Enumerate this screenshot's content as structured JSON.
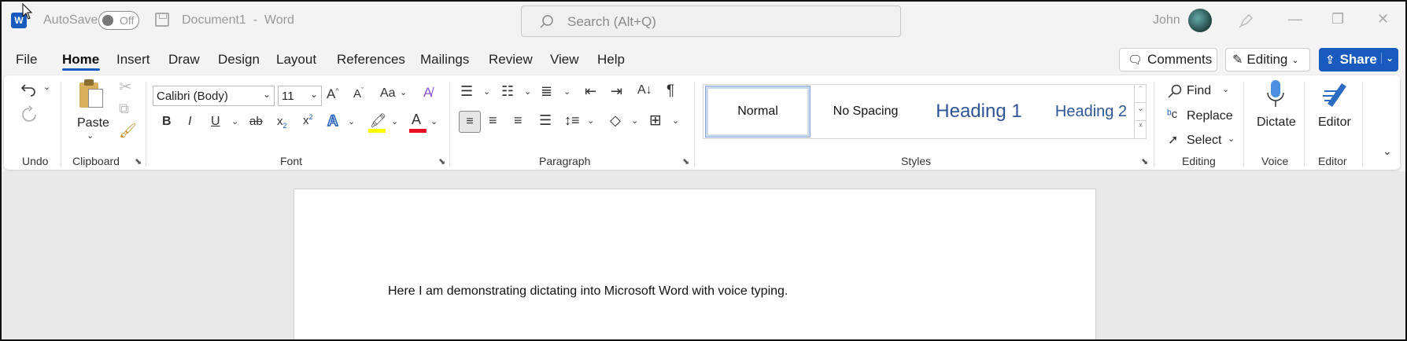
{
  "titlebar": {
    "app_icon": "word-icon",
    "autosave_label": "AutoSave",
    "autosave_state": "Off",
    "save_icon": "save-icon",
    "document_title": "Document1  -  Word",
    "search_placeholder": "Search (Alt+Q)",
    "user_name": "John"
  },
  "tabs": [
    "File",
    "Home",
    "Insert",
    "Draw",
    "Design",
    "Layout",
    "References",
    "Mailings",
    "Review",
    "View",
    "Help"
  ],
  "active_tab": "Home",
  "actions": {
    "comments_label": "Comments",
    "editing_label": "Editing",
    "share_label": "Share"
  },
  "ribbon": {
    "undo": {
      "label": "Undo"
    },
    "clipboard": {
      "label": "Clipboard",
      "paste_label": "Paste"
    },
    "font": {
      "label": "Font",
      "font_name": "Calibri (Body)",
      "font_size": "11",
      "case_label": "Aa"
    },
    "paragraph": {
      "label": "Paragraph"
    },
    "styles": {
      "label": "Styles",
      "items": [
        "Normal",
        "No Spacing",
        "Heading 1",
        "Heading 2"
      ],
      "heading_color": "#2f5597"
    },
    "editing": {
      "label": "Editing",
      "find_label": "Find",
      "replace_label": "Replace",
      "select_label": "Select"
    },
    "voice": {
      "label": "Voice",
      "dictate_label": "Dictate"
    },
    "editor": {
      "label": "Editor",
      "editor_label": "Editor"
    }
  },
  "document": {
    "body_text": "Here I am demonstrating dictating into Microsoft Word with voice typing."
  },
  "colors": {
    "accent": "#185abd",
    "highlight": "#ffff00",
    "font_color": "#e81123"
  }
}
